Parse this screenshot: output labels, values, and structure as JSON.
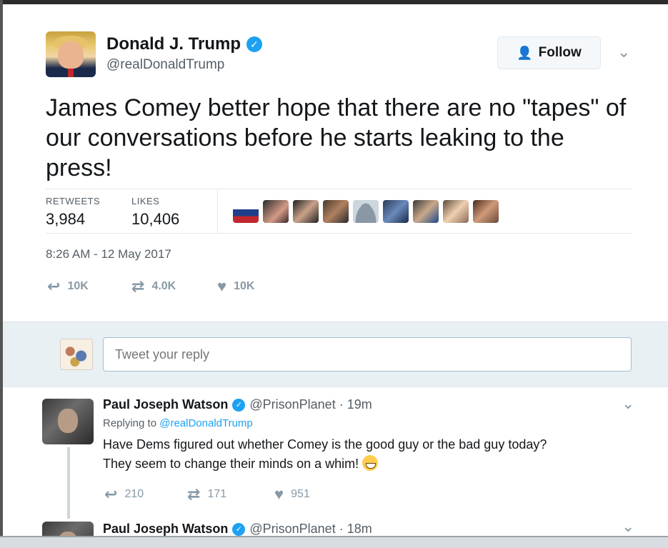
{
  "tweet": {
    "display_name": "Donald J. Trump",
    "screen_name": "@realDonaldTrump",
    "follow_label": "Follow",
    "text": "James Comey better hope that there are no \"tapes\" of our conversations before he starts leaking to the press!",
    "retweets_label": "RETWEETS",
    "retweets_value": "3,984",
    "likes_label": "LIKES",
    "likes_value": "10,406",
    "timestamp": "8:26 AM - 12 May 2017",
    "actions": {
      "reply": "10K",
      "retweet": "4.0K",
      "like": "10K"
    }
  },
  "reply_box": {
    "placeholder": "Tweet your reply"
  },
  "replies": [
    {
      "name": "Paul Joseph Watson",
      "handle": "@PrisonPlanet",
      "time": "19m",
      "replying_prefix": "Replying to",
      "replying_to": "@realDonaldTrump",
      "text_line1": "Have Dems figured out whether Comey is the good guy or the bad guy today?",
      "text_line2": "They seem to change their minds on a whim!",
      "actions": {
        "reply": "210",
        "retweet": "171",
        "like": "951"
      }
    },
    {
      "name": "Paul Joseph Watson",
      "handle": "@PrisonPlanet",
      "time": "18m"
    }
  ],
  "colors": {
    "accent": "#1da1f2",
    "muted": "#8899a6",
    "reply_band": "#e8f0f4"
  },
  "icons": [
    "verified-badge-icon",
    "follow-user-icon",
    "chevron-down-icon",
    "reply-icon",
    "retweet-icon",
    "heart-icon",
    "grin-emoji-icon"
  ]
}
